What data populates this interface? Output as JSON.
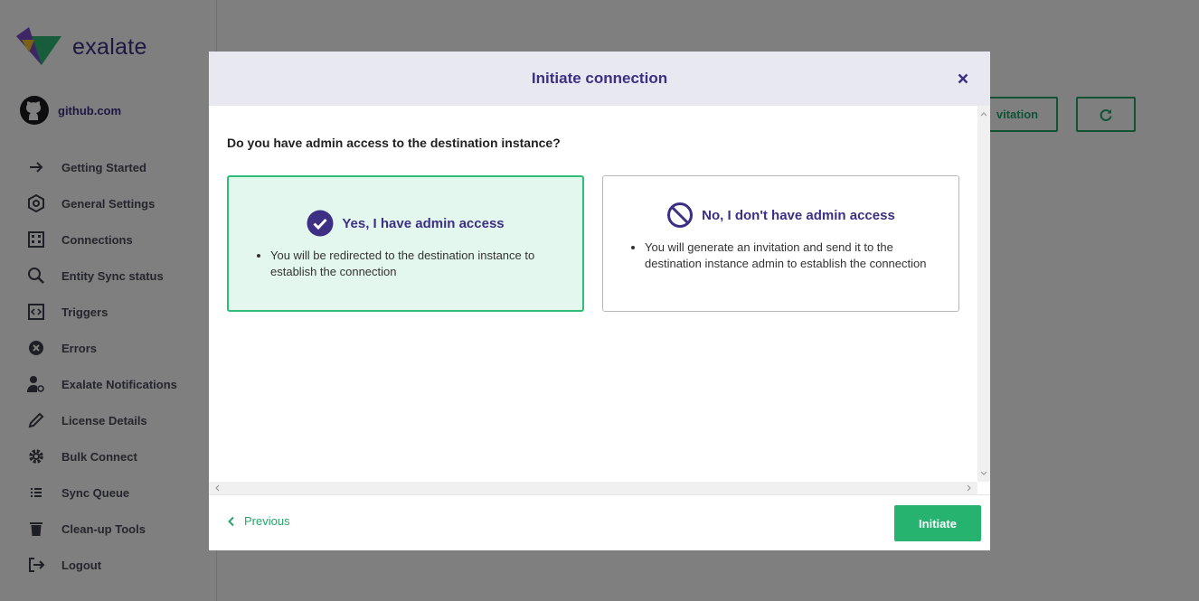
{
  "brand": {
    "name": "exalate",
    "color": "#3d2f84",
    "accent": "#25a56a"
  },
  "instance": {
    "name": "github.com",
    "icon": "github-icon"
  },
  "sidebar": {
    "items": [
      {
        "label": "Getting Started",
        "icon": "arrow-right-icon"
      },
      {
        "label": "General Settings",
        "icon": "hexagon-settings-icon"
      },
      {
        "label": "Connections",
        "icon": "building-icon"
      },
      {
        "label": "Entity Sync status",
        "icon": "search-icon"
      },
      {
        "label": "Triggers",
        "icon": "code-brackets-icon"
      },
      {
        "label": "Errors",
        "icon": "error-circle-icon"
      },
      {
        "label": "Exalate Notifications",
        "icon": "user-at-icon"
      },
      {
        "label": "License Details",
        "icon": "pencil-icon"
      },
      {
        "label": "Bulk Connect",
        "icon": "gear-icon"
      },
      {
        "label": "Sync Queue",
        "icon": "list-icon"
      },
      {
        "label": "Clean-up Tools",
        "icon": "trash-icon"
      },
      {
        "label": "Logout",
        "icon": "logout-icon"
      }
    ]
  },
  "page": {
    "invite_label": "vitation",
    "refresh_icon": "refresh-icon"
  },
  "modal": {
    "title": "Initiate connection",
    "close_icon": "close-icon",
    "question": "Do you have admin access to the destination instance?",
    "options": [
      {
        "title": "Yes, I have admin access",
        "icon": "check-circle-icon",
        "selected": true,
        "bullet": "You will be redirected to the destination instance to establish the connection"
      },
      {
        "title": "No, I don't have admin access",
        "icon": "ban-icon",
        "selected": false,
        "bullet": "You will generate an invitation and send it to the destination instance admin to establish the connection"
      }
    ],
    "footer": {
      "previous_label": "Previous",
      "initiate_label": "Initiate"
    }
  }
}
